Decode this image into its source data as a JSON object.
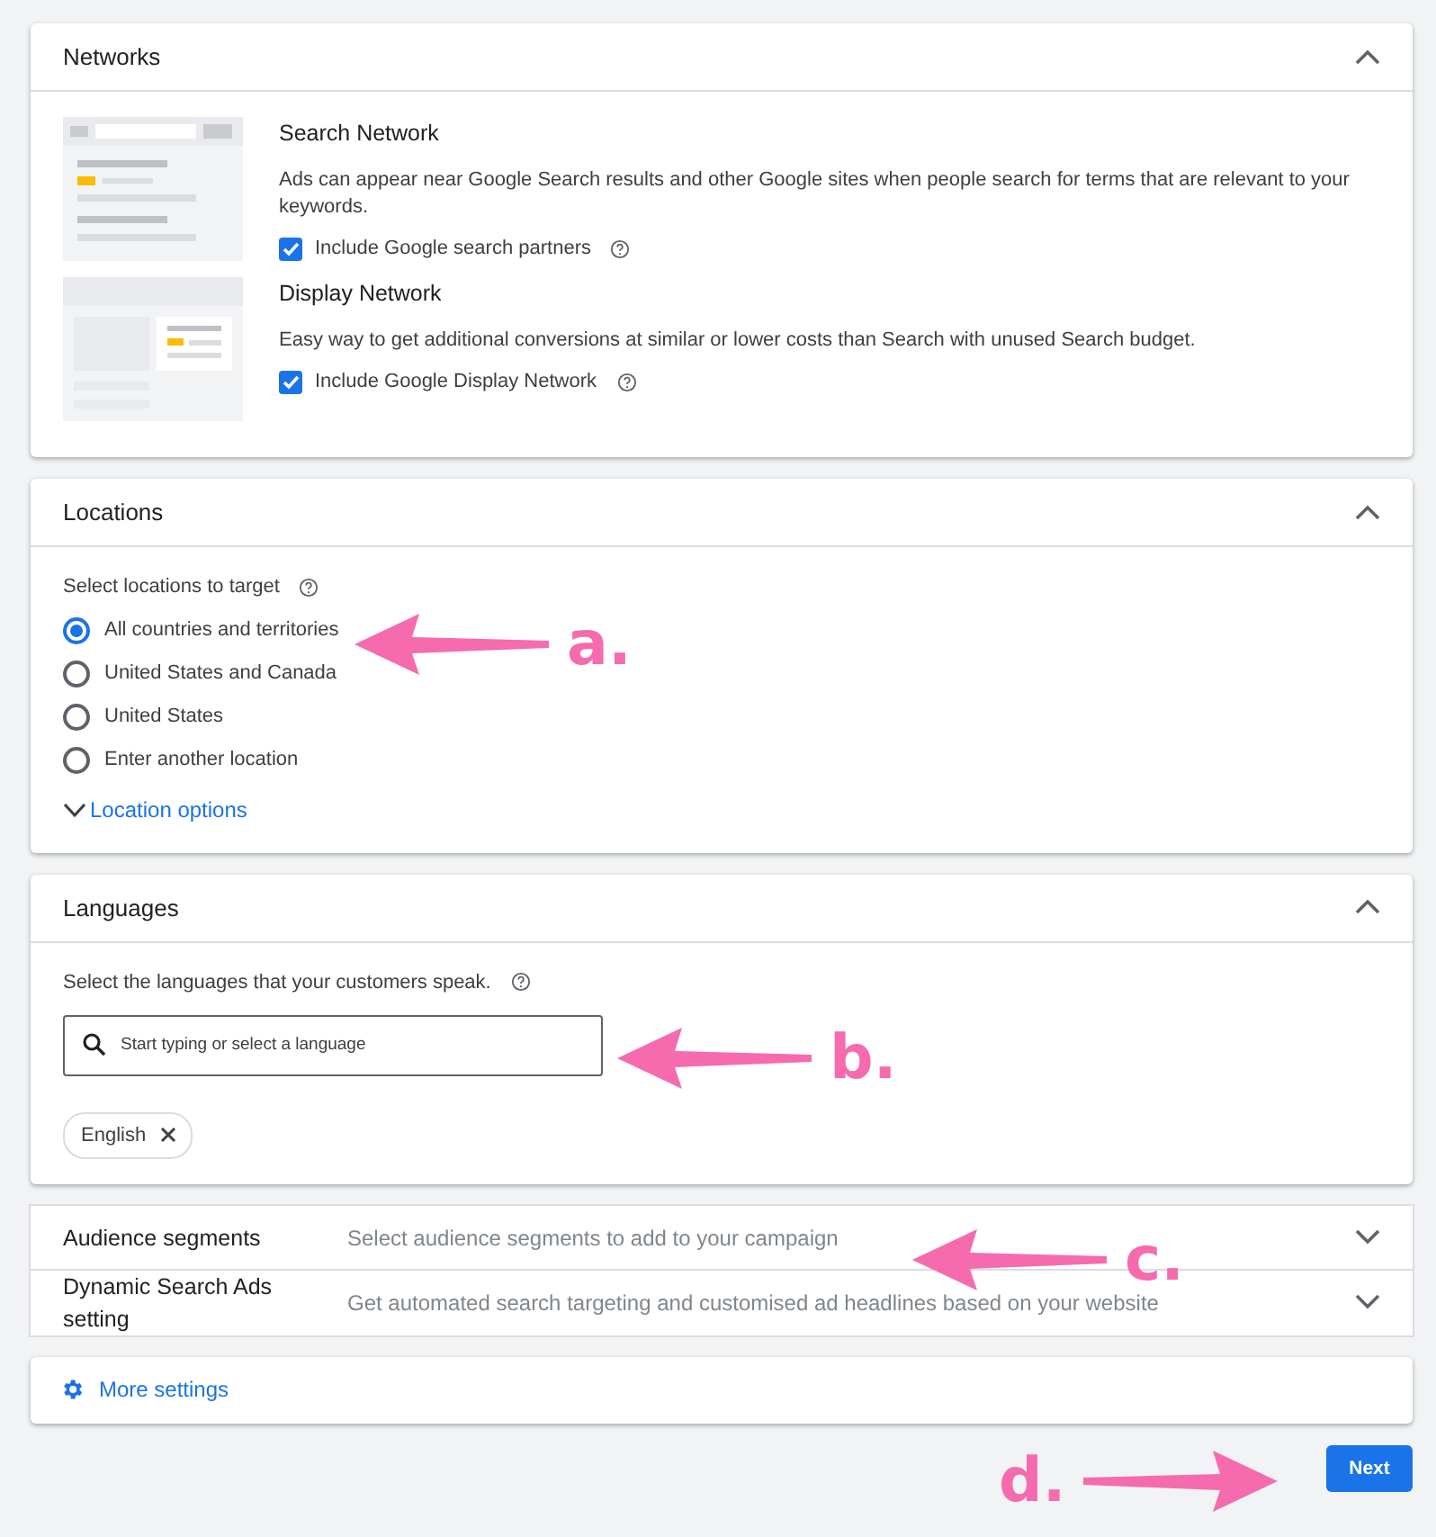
{
  "networks": {
    "title": "Networks",
    "expanded": true,
    "items": [
      {
        "kind": "search",
        "title": "Search Network",
        "description": "Ads can appear near Google Search results and other Google sites when people search for terms that are relevant to your keywords.",
        "option": "Include Google search partners",
        "checked": true
      },
      {
        "kind": "display",
        "title": "Display Network",
        "description": "Easy way to get additional conversions at similar or lower costs than Search with unused Search budget.",
        "option": "Include Google Display Network",
        "checked": true
      }
    ]
  },
  "locations": {
    "title": "Locations",
    "expanded": true,
    "prompt": "Select locations to target",
    "options": [
      {
        "label": "All countries and territories",
        "selected": true
      },
      {
        "label": "United States and Canada",
        "selected": false
      },
      {
        "label": "United States",
        "selected": false
      },
      {
        "label": "Enter another location",
        "selected": false
      }
    ],
    "more_link": "Location options"
  },
  "languages": {
    "title": "Languages",
    "expanded": true,
    "prompt": "Select the languages that your customers speak.",
    "search": {
      "placeholder": "Start typing or select a language"
    },
    "chips": [
      "English"
    ]
  },
  "collapsed_sections": [
    {
      "title": "Audience segments",
      "summary": "Select audience segments to add to your campaign",
      "expanded": false
    },
    {
      "title": "Dynamic Search Ads setting",
      "summary": "Get automated search targeting and customised ad headlines based on your website",
      "expanded": false
    }
  ],
  "more_settings": "More settings",
  "next_button": "Next",
  "annotations": [
    {
      "label": "a.",
      "kind": "left"
    },
    {
      "label": "b.",
      "kind": "left"
    },
    {
      "label": "c.",
      "kind": "left"
    },
    {
      "label": "d.",
      "kind": "right"
    }
  ]
}
